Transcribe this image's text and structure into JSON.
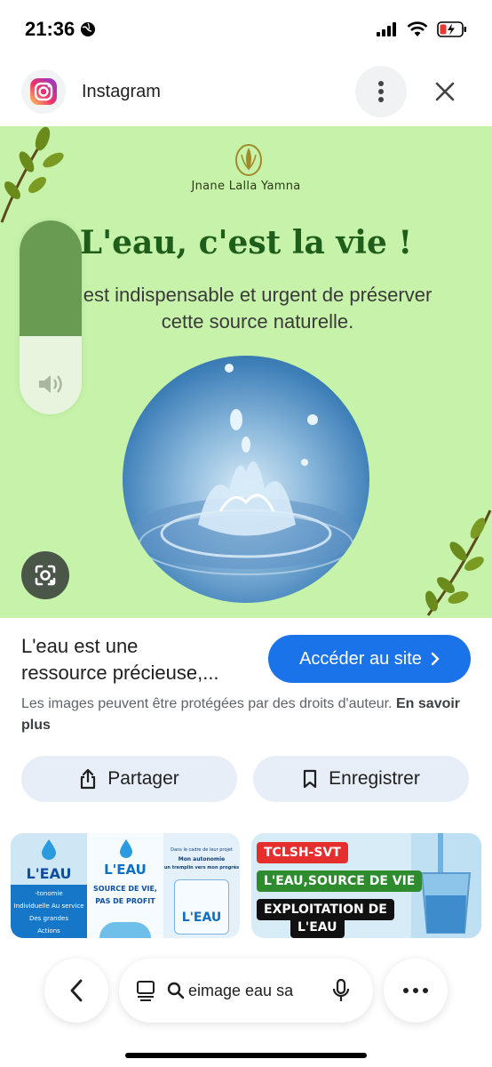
{
  "status_bar": {
    "time": "21:36",
    "icons": [
      "globe-icon",
      "signal-icon",
      "wifi-icon",
      "battery-charging-icon"
    ]
  },
  "header": {
    "app_name": "Instagram",
    "icons": [
      "instagram-logo-icon",
      "more-vertical-icon",
      "close-icon"
    ]
  },
  "image": {
    "brand": "Jnane Lalla Yamna",
    "headline": "L'eau, c'est la vie !",
    "subline_1": "est indispensable et urgent de préserver",
    "subline_2": "cette source naturelle.",
    "volume_level": 0.4,
    "colors": {
      "background": "#c6f3a9",
      "headline": "#1f5e1a"
    }
  },
  "result": {
    "title_line_1": "L'eau est une",
    "title_line_2": "ressource précieuse,...",
    "visit_button": "Accéder au site",
    "copyright_text": "Les images peuvent être protégées par des droits d'auteur.",
    "learn_more": "En savoir plus"
  },
  "actions": {
    "share": "Partager",
    "save": "Enregistrer"
  },
  "related": {
    "left": {
      "col1_title": "L'EAU",
      "col1_lines": [
        "-tonomie",
        "Individuelle Au service",
        "Des grandes",
        "Actions"
      ],
      "col2_title": "L'EAU",
      "col2_sub_1": "SOURCE DE VIE,",
      "col2_sub_2": "PAS DE PROFIT",
      "col3_lines": [
        "Dans le cadre de leur projet",
        "Mon autonomie",
        "un tremplin vers mon progrès"
      ],
      "col3_title": "L'EAU"
    },
    "right": {
      "tag_1": "TCLSH-SVT",
      "tag_2": "L'EAU,SOURCE DE VIE",
      "tag_3": "EXPLOITATION DE",
      "tag_4": "L'EAU"
    }
  },
  "toolbar": {
    "search_text": "eimage eau sa",
    "icons": [
      "back-icon",
      "tabs-icon",
      "search-icon",
      "microphone-icon",
      "more-horizontal-icon"
    ]
  },
  "colors": {
    "accent": "#1a73e8",
    "action_bg": "#e8eef8"
  }
}
